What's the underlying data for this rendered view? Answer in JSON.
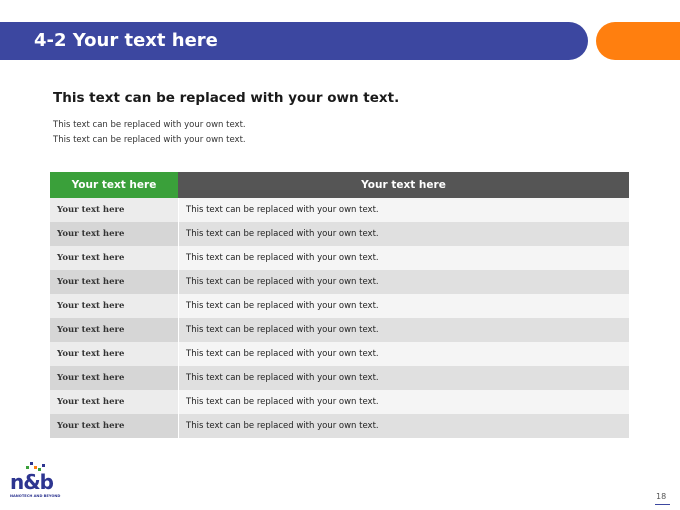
{
  "header": {
    "title": "4-2 Your text here",
    "bar_color": "#3c47a0",
    "accent_color": "#ff7f0f"
  },
  "content": {
    "subheading": "This text can be replaced with your own text.",
    "body_lines": [
      "This text can be replaced with your own text.",
      "This text can be replaced with your own text."
    ]
  },
  "table": {
    "headers": [
      "Your text here",
      "Your text here"
    ],
    "header_colors": [
      "#3aa03a",
      "#555555"
    ],
    "rows": [
      [
        "Your text here",
        "This text can be replaced with your own text."
      ],
      [
        "Your text here",
        "This text can be replaced with your own text."
      ],
      [
        "Your text here",
        "This text can be replaced with your own text."
      ],
      [
        "Your text here",
        "This text can be replaced with your own text."
      ],
      [
        "Your text here",
        "This text can be replaced with your own text."
      ],
      [
        "Your text here",
        "This text can be replaced with your own text."
      ],
      [
        "Your text here",
        "This text can be replaced with your own text."
      ],
      [
        "Your text here",
        "This text can be replaced with your own text."
      ],
      [
        "Your text here",
        "This text can be replaced with your own text."
      ],
      [
        "Your text here",
        "This text can be replaced with your own text."
      ]
    ]
  },
  "footer": {
    "logo_text": "n&b",
    "logo_tagline": "NANOTECH AND BEYOND",
    "page_number": "18"
  }
}
